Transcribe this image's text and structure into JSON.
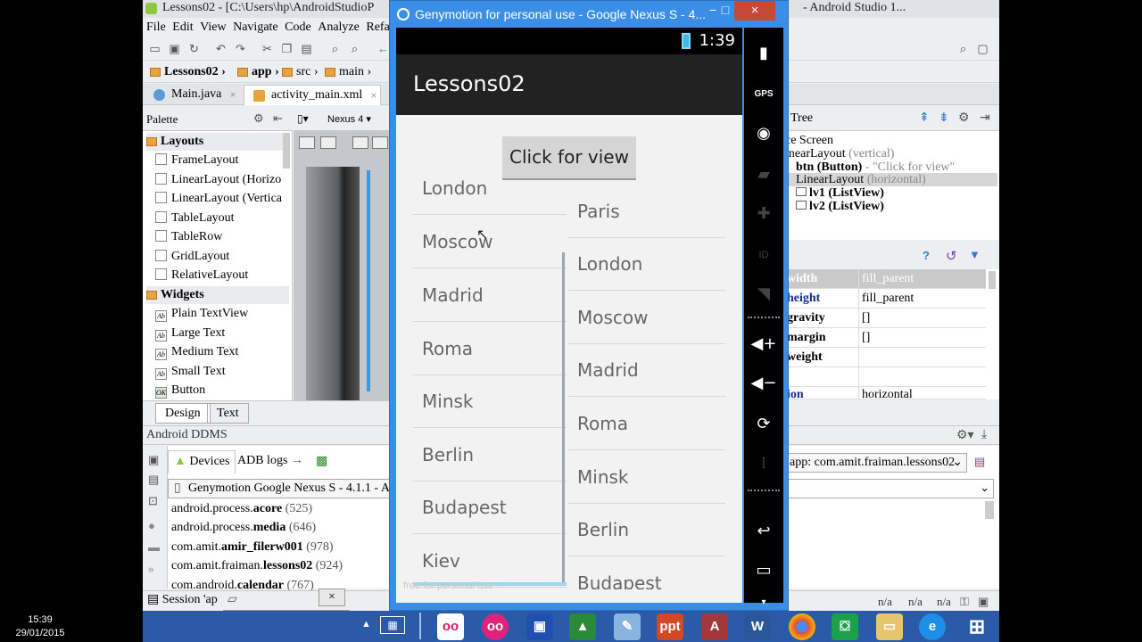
{
  "studio": {
    "title_left": "Lessons02 - [C:\\Users\\hp\\AndroidStudioP",
    "title_right": "- Android Studio 1...",
    "menu": [
      "File",
      "Edit",
      "View",
      "Navigate",
      "Code",
      "Analyze",
      "Refa"
    ],
    "breadcrumb": [
      "Lessons02",
      "app",
      "src",
      "main"
    ],
    "tabs": [
      {
        "label": "Main.java",
        "close": "×"
      },
      {
        "label": "activity_main.xml",
        "close": "×"
      }
    ],
    "palette": {
      "title": "Palette",
      "device": "Nexus 4",
      "cat_layouts": "Layouts",
      "layouts": [
        "FrameLayout",
        "LinearLayout (Horizo",
        "LinearLayout (Vertica",
        "TableLayout",
        "TableRow",
        "GridLayout",
        "RelativeLayout"
      ],
      "cat_widgets": "Widgets",
      "widgets": [
        "Plain TextView",
        "Large Text",
        "Medium Text",
        "Small Text",
        "Button"
      ],
      "widget_icon": "Ab",
      "button_icon": "OK"
    },
    "design_tab": "Design",
    "text_tab": "Text",
    "tree": {
      "title": "Tree",
      "rows": [
        {
          "name": "ce Screen",
          "detail": ""
        },
        {
          "name": "inearLayout",
          "detail": "(vertical)"
        },
        {
          "name": "btn (Button)",
          "detail": "- \"Click for view\""
        },
        {
          "name": "LinearLayout",
          "detail": "(horizontal)"
        },
        {
          "name": "lv1 (ListView)",
          "detail": ""
        },
        {
          "name": "lv2 (ListView)",
          "detail": ""
        }
      ]
    },
    "properties": [
      {
        "key": "width",
        "value": "fill_parent"
      },
      {
        "key": "height",
        "value": "fill_parent"
      },
      {
        "key": "gravity",
        "value": "[]"
      },
      {
        "key": "margin",
        "value": "[]"
      },
      {
        "key": "weight",
        "value": ""
      },
      {
        "key": "",
        "value": ""
      },
      {
        "key": "ion",
        "value": "horizontal"
      }
    ],
    "ddms": {
      "title": "Android DDMS",
      "devices_tab": "Devices",
      "adb_tab": "ADB logs",
      "device": "Genymotion Google Nexus S - 4.1.1 - A",
      "processes": [
        {
          "prefix": "android.process.",
          "bold": "acore",
          "pid": "(525)"
        },
        {
          "prefix": "android.process.",
          "bold": "media",
          "pid": "(646)"
        },
        {
          "prefix": "com.amit.",
          "bold": "amir_filerw001",
          "pid": "(978)"
        },
        {
          "prefix": "com.amit.fraiman.",
          "bold": "lessons02",
          "pid": "(924)"
        },
        {
          "prefix": "com.android.",
          "bold": "calendar",
          "pid": "(767)"
        }
      ],
      "app_filter": "app: com.amit.fraiman.lessons02"
    },
    "session_label": "Session 'ap",
    "session_close": "×",
    "status_cells": [
      "n/a",
      "n/a",
      "n/a"
    ]
  },
  "recorder": {
    "buttons": [
      "M",
      "×",
      "●",
      "II",
      "■",
      "▶"
    ]
  },
  "genymotion": {
    "title": "Genymotion for personal use - Google Nexus S - 4...",
    "minimize": "−",
    "maximize": "□",
    "close": "×",
    "clock": "1:39",
    "app_title": "Lessons02",
    "button_label": "Click for view",
    "list1": [
      "London",
      "Moscow",
      "Madrid",
      "Roma",
      "Minsk",
      "Berlin",
      "Budapest",
      "Kiev"
    ],
    "list2": [
      "Paris",
      "London",
      "Moscow",
      "Madrid",
      "Roma",
      "Minsk",
      "Berlin",
      "Budapest"
    ],
    "watermark": "free for personal use",
    "sidebar": {
      "gps": "GPS",
      "id": "ID"
    }
  },
  "taskbar": {
    "time": "15:39",
    "date": "29/01/2015",
    "apps": [
      "oo",
      "ppt",
      "A",
      "W"
    ]
  }
}
